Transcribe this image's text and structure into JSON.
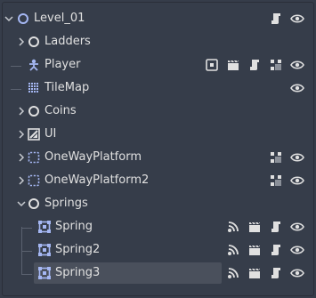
{
  "scene_tree": {
    "rows": [
      {
        "label": "Level_01"
      },
      {
        "label": "Ladders"
      },
      {
        "label": "Player"
      },
      {
        "label": "TileMap"
      },
      {
        "label": "Coins"
      },
      {
        "label": "UI"
      },
      {
        "label": "OneWayPlatform"
      },
      {
        "label": "OneWayPlatform2"
      },
      {
        "label": "Springs"
      },
      {
        "label": "Spring"
      },
      {
        "label": "Spring2"
      },
      {
        "label": "Spring3"
      }
    ]
  },
  "colors": {
    "background": "#363d4a",
    "selection": "#4a505c",
    "node_2d_blue": "#a5b7f3",
    "node_control_green": "#a5efac",
    "icon_light": "#e0e0e0"
  }
}
